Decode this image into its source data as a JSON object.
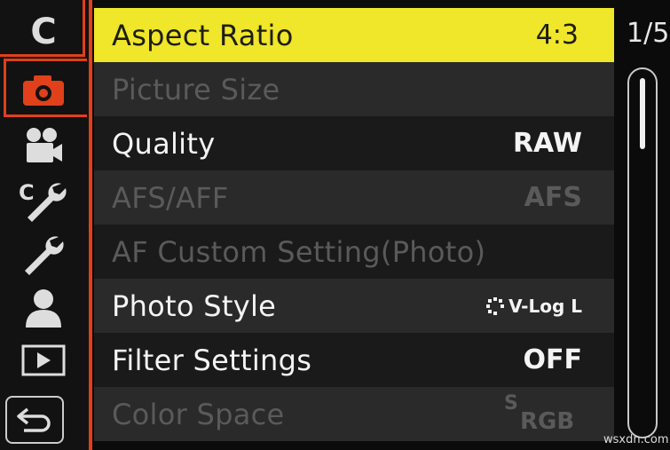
{
  "tabs": [
    {
      "name": "custom-mode-tab",
      "label": "C"
    },
    {
      "name": "photo-tab",
      "icon": "camera-icon"
    },
    {
      "name": "video-tab",
      "icon": "video-camera-icon"
    },
    {
      "name": "custom-settings-tab",
      "icon": "custom-wrench-icon"
    },
    {
      "name": "setup-tab",
      "icon": "wrench-icon"
    },
    {
      "name": "my-menu-tab",
      "icon": "person-icon"
    },
    {
      "name": "playback-tab",
      "icon": "play-icon"
    },
    {
      "name": "back-button",
      "icon": "return-arrow-icon"
    }
  ],
  "menu": {
    "items": [
      {
        "label": "Aspect Ratio",
        "value": "4:3",
        "state": "selected"
      },
      {
        "label": "Picture Size",
        "value": "",
        "state": "disabled"
      },
      {
        "label": "Quality",
        "value": "RAW",
        "state": "enabled"
      },
      {
        "label": "AFS/AFF",
        "value": "AFS",
        "state": "disabled"
      },
      {
        "label": "AF Custom Setting(Photo)",
        "value": "",
        "state": "disabled"
      },
      {
        "label": "Photo Style",
        "value": "V-Log L",
        "state": "enabled"
      },
      {
        "label": "Filter Settings",
        "value": "OFF",
        "state": "enabled"
      },
      {
        "label": "Color Space",
        "value_prefix": "S",
        "value": "RGB",
        "state": "disabled"
      }
    ]
  },
  "page_indicator": "1/5",
  "scroll_position": 0,
  "watermark": "wsxdn.com",
  "colors": {
    "accent": "#e0401a",
    "highlight": "#f0e62a"
  }
}
